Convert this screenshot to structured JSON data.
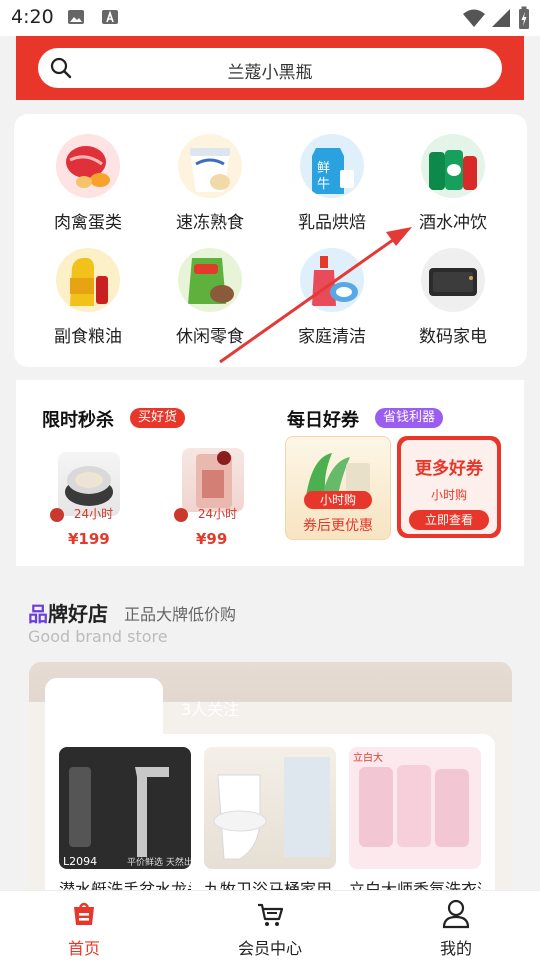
{
  "status_bar": {
    "time": "4:20"
  },
  "search": {
    "query": "兰蔻小黑瓶"
  },
  "categories": [
    {
      "label": "肉禽蛋类",
      "icon": "meat-eggs-icon"
    },
    {
      "label": "速冻熟食",
      "icon": "frozen-food-icon"
    },
    {
      "label": "乳品烘焙",
      "icon": "dairy-bakery-icon"
    },
    {
      "label": "酒水冲饮",
      "icon": "drinks-icon"
    },
    {
      "label": "副食粮油",
      "icon": "grain-oil-icon"
    },
    {
      "label": "休闲零食",
      "icon": "snacks-icon"
    },
    {
      "label": "家庭清洁",
      "icon": "cleaning-icon"
    },
    {
      "label": "数码家电",
      "icon": "digital-appliance-icon"
    }
  ],
  "flash_sale": {
    "title": "限时秒杀",
    "tag": "买好货",
    "items": [
      {
        "delivery": "24小时",
        "price": "¥199"
      },
      {
        "delivery": "24小时",
        "price": "¥99"
      }
    ]
  },
  "daily_coupon": {
    "title": "每日好券",
    "tag": "省钱利器",
    "card1": {
      "badge": "小时购",
      "caption": "券后更优惠"
    },
    "card2": {
      "title": "更多好券",
      "badge": "小时购",
      "button": "立即查看"
    }
  },
  "brand": {
    "title": "品牌好店",
    "subtitle": "正品大牌低价购",
    "subtitle_en": "Good brand store",
    "followers": "3人关注",
    "products": [
      {
        "name": "潜水艇洗手盆水龙头"
      },
      {
        "name": "九牧卫浴马桶家用"
      },
      {
        "name": "立白大师香氛洗衣液"
      }
    ],
    "product_labels": [
      "L2094",
      "平价鲜选 天然出水",
      "立白大"
    ]
  },
  "tabbar": {
    "items": [
      {
        "label": "首页",
        "icon": "home-icon",
        "active": true
      },
      {
        "label": "会员中心",
        "icon": "cart-icon",
        "active": false
      },
      {
        "label": "我的",
        "icon": "profile-icon",
        "active": false
      }
    ]
  },
  "colors": {
    "brand_red": "#e8372a",
    "price_red": "#e23b2b",
    "purple_tag": "#9b5cf0"
  }
}
